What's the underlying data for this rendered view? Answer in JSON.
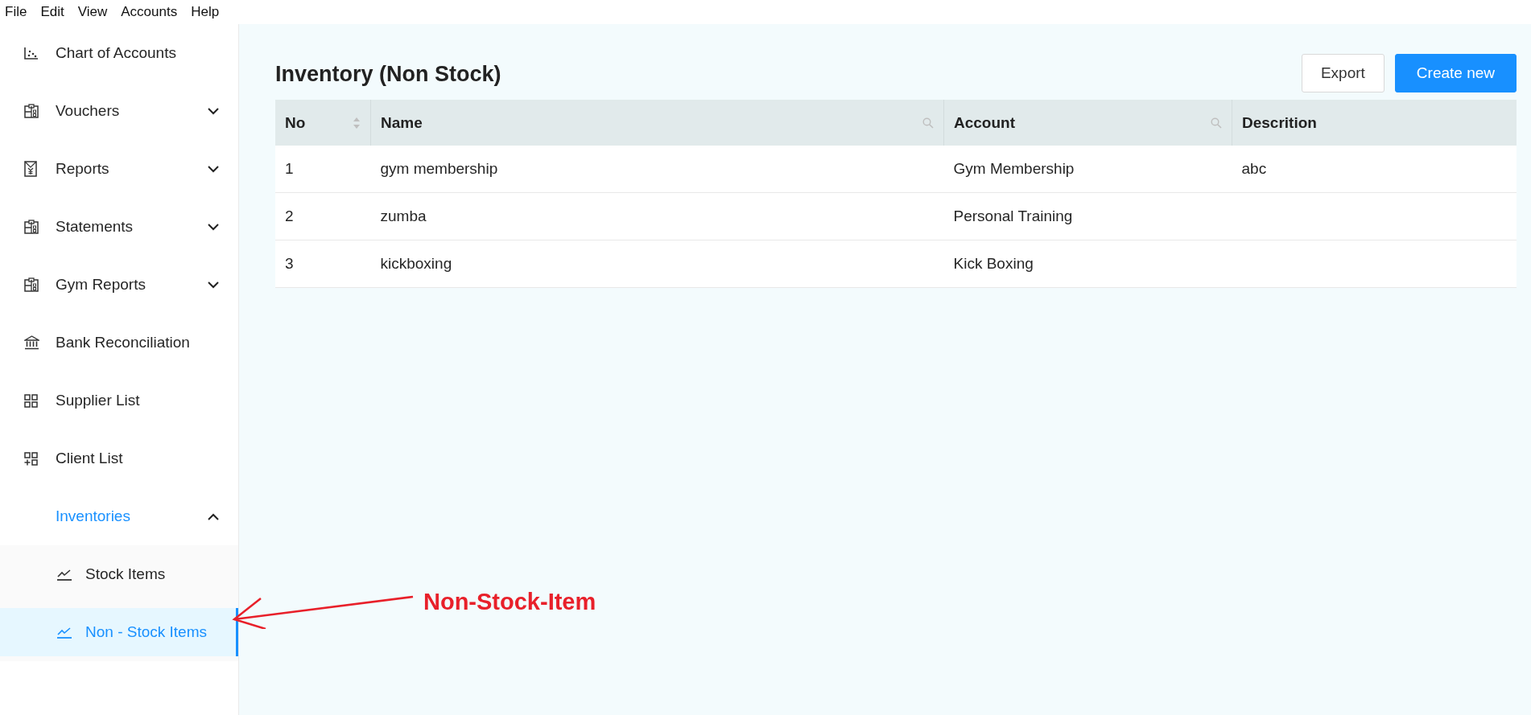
{
  "menu_bar": [
    "File",
    "Edit",
    "View",
    "Accounts",
    "Help"
  ],
  "sidebar": {
    "items": [
      {
        "label": "Chart of Accounts",
        "kind": "chart",
        "selected": false
      },
      {
        "label": "Vouchers",
        "kind": "clipboard",
        "selected": false,
        "expanded": false
      },
      {
        "label": "Reports",
        "kind": "yen",
        "selected": false,
        "expanded": false
      },
      {
        "label": "Statements",
        "kind": "clipboard",
        "selected": false,
        "expanded": false
      },
      {
        "label": "Gym Reports",
        "kind": "clipboard",
        "selected": false,
        "expanded": false
      },
      {
        "label": "Bank Reconciliation",
        "kind": "bank",
        "selected": false
      },
      {
        "label": "Supplier List",
        "kind": "grid",
        "selected": false
      },
      {
        "label": "Client List",
        "kind": "grid-plus",
        "selected": false
      },
      {
        "label": "Inventories",
        "kind": "none",
        "selected": true,
        "expanded": true,
        "children": [
          {
            "label": "Stock Items",
            "kind": "line-chart",
            "selected": false
          },
          {
            "label": "Non - Stock Items",
            "kind": "line-chart",
            "selected": true
          }
        ]
      }
    ]
  },
  "page": {
    "title": "Inventory (Non Stock)",
    "buttons": [
      {
        "label": "Export",
        "kind": "default"
      },
      {
        "label": "Create new",
        "kind": "primary"
      }
    ]
  },
  "table": {
    "columns": [
      {
        "label": "No",
        "sortable": true,
        "searchable": false
      },
      {
        "label": "Name",
        "sortable": false,
        "searchable": true
      },
      {
        "label": "Account",
        "sortable": false,
        "searchable": true
      },
      {
        "label": "Descrition",
        "sortable": false,
        "searchable": false
      }
    ],
    "rows": [
      [
        "1",
        "gym membership",
        "Gym Membership",
        "abc"
      ],
      [
        "2",
        "zumba",
        "Personal Training",
        ""
      ],
      [
        "3",
        "kickboxing",
        "Kick Boxing",
        ""
      ]
    ]
  },
  "annotation": {
    "label": "Non-Stock-Item"
  }
}
